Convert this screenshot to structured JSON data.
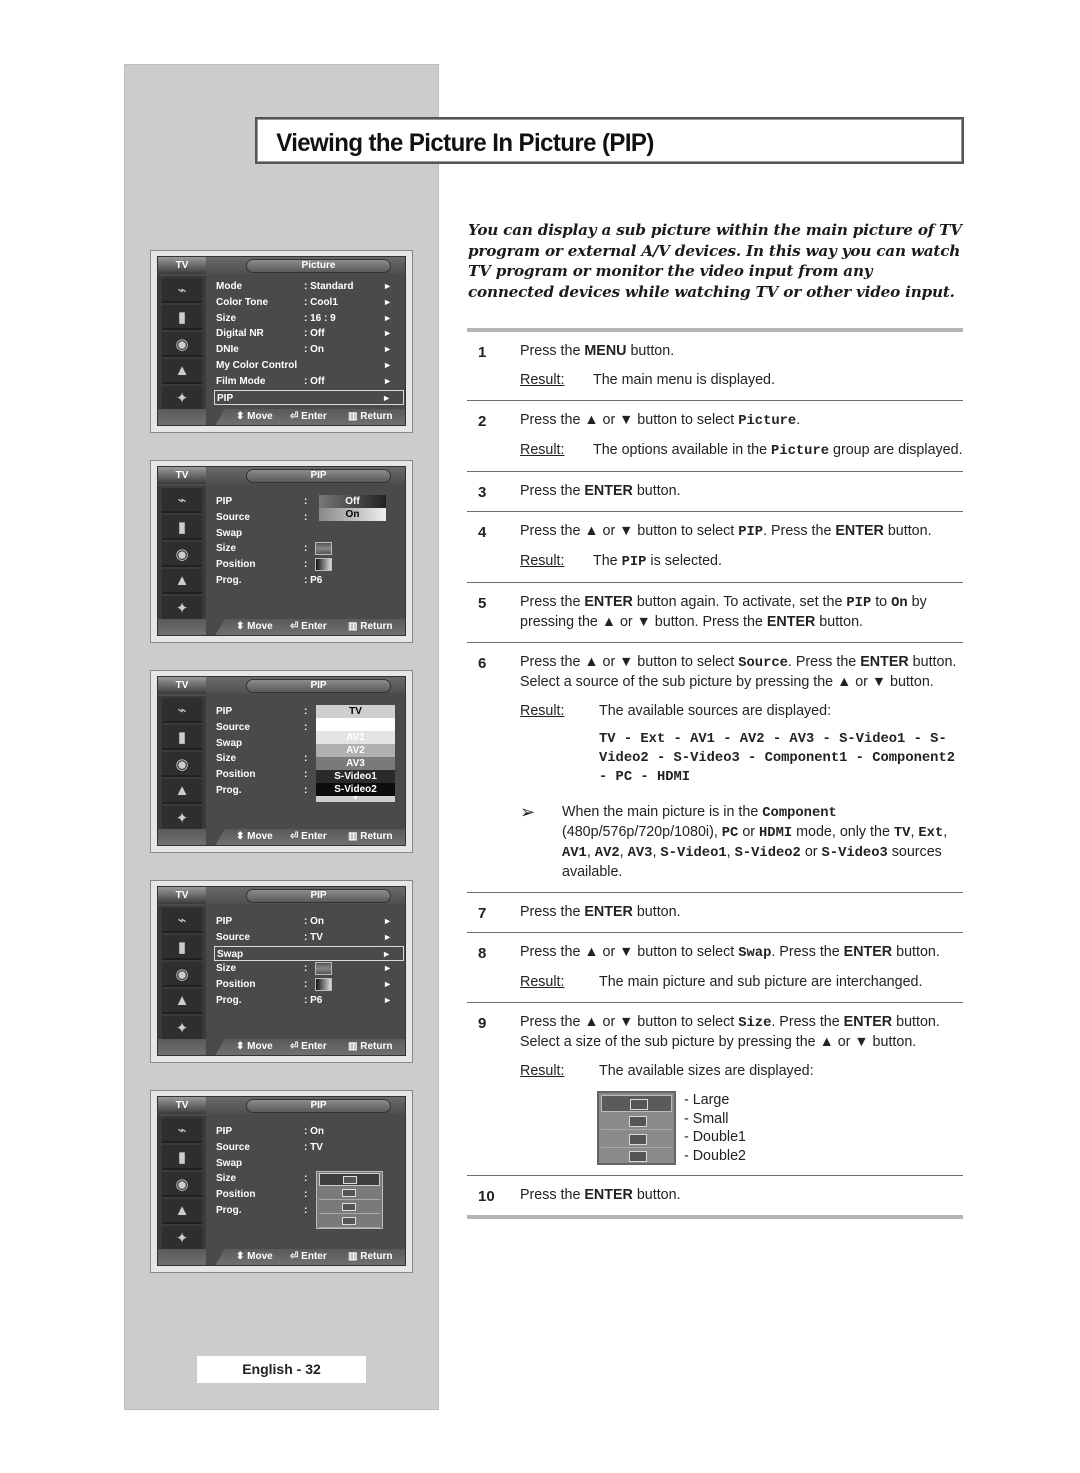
{
  "page": {
    "title": "Viewing the Picture In Picture (PIP)",
    "intro": "You can display a sub picture within the main picture of TV program or external A/V devices. In this way you can watch TV program or monitor the video input from any connected devices while watching TV or other video input.",
    "footer": "English - 32"
  },
  "menu_common": {
    "tv_label": "TV",
    "footer_move": "Move",
    "footer_enter": "Enter",
    "footer_return": "Return",
    "icons": [
      "input-plug-icon",
      "picture-icon",
      "sound-icon",
      "channel-icon",
      "setup-icon"
    ]
  },
  "menus": [
    {
      "header": "Picture",
      "rows": [
        {
          "label": "Mode",
          "value": ": Standard",
          "arrow": "►"
        },
        {
          "label": "Color Tone",
          "value": ": Cool1",
          "arrow": "►"
        },
        {
          "label": "Size",
          "value": ": 16 : 9",
          "arrow": "►"
        },
        {
          "label": "Digital NR",
          "value": ": Off",
          "arrow": "►"
        },
        {
          "label": "DNIe",
          "value": ": On",
          "arrow": "►"
        },
        {
          "label": "My Color Control",
          "value": "",
          "arrow": "►"
        },
        {
          "label": "Film Mode",
          "value": ": Off",
          "arrow": "►"
        },
        {
          "label": "PIP",
          "value": "",
          "arrow": "►"
        }
      ],
      "selected": "PIP"
    },
    {
      "header": "PIP",
      "rows": [
        {
          "label": "PIP",
          "value": ":"
        },
        {
          "label": "Source",
          "value": ":"
        },
        {
          "label": "Swap",
          "value": ""
        },
        {
          "label": "Size",
          "value": ":"
        },
        {
          "label": "Position",
          "value": ":"
        },
        {
          "label": "Prog.",
          "value": ": P6"
        }
      ],
      "popup_options": [
        "Off",
        "On"
      ],
      "popup_selected": "On"
    },
    {
      "header": "PIP",
      "rows": [
        {
          "label": "PIP",
          "value": ":"
        },
        {
          "label": "Source",
          "value": ":"
        },
        {
          "label": "Swap",
          "value": ""
        },
        {
          "label": "Size",
          "value": ":"
        },
        {
          "label": "Position",
          "value": ":"
        },
        {
          "label": "Prog.",
          "value": ":"
        }
      ],
      "popup_options": [
        "TV",
        "",
        "AV1",
        "AV2",
        "AV3",
        "S-Video1",
        "S-Video2"
      ],
      "popup_selected": "TV"
    },
    {
      "header": "PIP",
      "rows": [
        {
          "label": "PIP",
          "value": ": On",
          "arrow": "►"
        },
        {
          "label": "Source",
          "value": ": TV",
          "arrow": "►"
        },
        {
          "label": "Swap",
          "value": "",
          "arrow": "►"
        },
        {
          "label": "Size",
          "value": ":",
          "arrow": "►"
        },
        {
          "label": "Position",
          "value": ":",
          "arrow": "►"
        },
        {
          "label": "Prog.",
          "value": ": P6",
          "arrow": "►"
        }
      ],
      "selected": "Swap"
    },
    {
      "header": "PIP",
      "rows": [
        {
          "label": "PIP",
          "value": ": On"
        },
        {
          "label": "Source",
          "value": ": TV"
        },
        {
          "label": "Swap",
          "value": ""
        },
        {
          "label": "Size",
          "value": ":"
        },
        {
          "label": "Position",
          "value": ":"
        },
        {
          "label": "Prog.",
          "value": ":"
        }
      ],
      "popup_options": [
        "Large",
        "Small",
        "Double1",
        "Double2"
      ],
      "popup_selected": "Large"
    }
  ],
  "steps": {
    "result_label": "Result",
    "s1": {
      "num": "1",
      "a": "Press the ",
      "b": "MENU",
      "c": " button.",
      "result": "The main menu is displayed."
    },
    "s2": {
      "num": "2",
      "a": "Press the ▲ or ▼ button to select ",
      "code": "Picture",
      "c": ".",
      "r1": "The options available in the ",
      "rcode": "Picture",
      "r2": " group are displayed."
    },
    "s3": {
      "num": "3",
      "a": "Press the ",
      "b": "ENTER",
      "c": " button."
    },
    "s4": {
      "num": "4",
      "a": "Press the ▲ or ▼ button to select ",
      "code": "PIP",
      "c": ". Press the ",
      "b": "ENTER",
      "d": " button.",
      "r1": "The ",
      "rcode": "PIP",
      "r2": " is selected."
    },
    "s5": {
      "num": "5",
      "a": "Press the ",
      "b": "ENTER",
      "c": " button again. To activate, set the ",
      "code1": "PIP",
      "d": " to ",
      "code2": "On",
      "e": " by pressing the ▲ or ▼ button. Press the ",
      "b2": "ENTER",
      "f": " button."
    },
    "s6": {
      "num": "6",
      "a": "Press the ▲ or ▼ button to select ",
      "code": "Source",
      "c": ". Press the ",
      "b": "ENTER",
      "d": " button. Select a source of the sub picture by pressing the ▲ or ▼ button.",
      "result": "The available sources are displayed:",
      "sources": "TV - Ext - AV1 - AV2 - AV3 - S-Video1 - S-Video2 - S-Video3 - Component1 - Component2 - PC - HDMI",
      "note": {
        "arrow": "➢",
        "a": "When the main picture is in the ",
        "c1": "Component",
        "b": " (480p/576p/720p/1080i), ",
        "c2": "PC",
        "d": " or ",
        "c3": "HDMI",
        "e": " mode, only the ",
        "c4": "TV",
        "c5": "Ext",
        "c6": "AV1",
        "c7": "AV2",
        "c8": "AV3",
        "c9": "S-Video1",
        "c10": "S-Video2",
        "or": " or ",
        "c11": "S-Video3",
        "f": " sources available.",
        "sep": ", "
      }
    },
    "s7": {
      "num": "7",
      "a": "Press the ",
      "b": "ENTER",
      "c": " button."
    },
    "s8": {
      "num": "8",
      "a": "Press the ▲ or ▼ button to select ",
      "code": "Swap",
      "c": ". Press the ",
      "b": "ENTER",
      "d": " button.",
      "result": "The main picture and sub picture are interchanged."
    },
    "s9": {
      "num": "9",
      "a": "Press the ▲ or ▼ button to select ",
      "code": "Size",
      "c": ". Press the ",
      "b": "ENTER",
      "d": " button. Select a size of the sub picture by pressing the ▲ or ▼ button.",
      "result": "The available sizes are displayed:",
      "sizes": [
        "- Large",
        "- Small",
        "- Double1",
        "- Double2"
      ]
    },
    "s10": {
      "num": "10",
      "a": "Press the ",
      "b": "ENTER",
      "c": " button."
    }
  }
}
